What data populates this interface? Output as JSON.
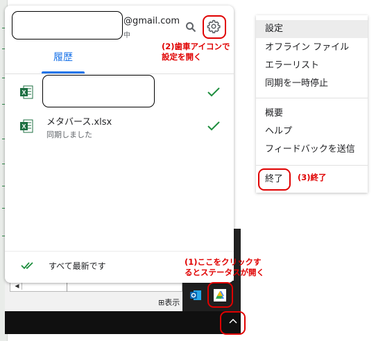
{
  "popup": {
    "account_email": "@gmail.com",
    "account_sub": "中",
    "tab_history": "履歴",
    "files": [
      {
        "name": "",
        "status": ""
      },
      {
        "name": "メタバース.xlsx",
        "status": "同期しました"
      }
    ],
    "footer_status": "すべて最新です"
  },
  "taskbar": {
    "display_label": "表示",
    "scroll_left_glyph": "◀"
  },
  "menu": {
    "items": [
      {
        "label": "設定"
      },
      {
        "label": "オフライン ファイル"
      },
      {
        "label": "エラーリスト"
      },
      {
        "label": "同期を一時停止"
      },
      {
        "label": "概要"
      },
      {
        "label": "ヘルプ"
      },
      {
        "label": "フィードバックを送信"
      },
      {
        "label": "終了"
      }
    ]
  },
  "annotations": {
    "gear_line1": "(2)歯車アイコンで",
    "gear_line2": "設定を開く",
    "tray_line1": "(1)ここをクリックす",
    "tray_line2": "るとステータスが開く",
    "quit": "(3)終了",
    "color": "#e00000"
  },
  "colors": {
    "accent": "#1a73e8",
    "check": "#1e8e3e",
    "excel": "#1d6f42"
  }
}
